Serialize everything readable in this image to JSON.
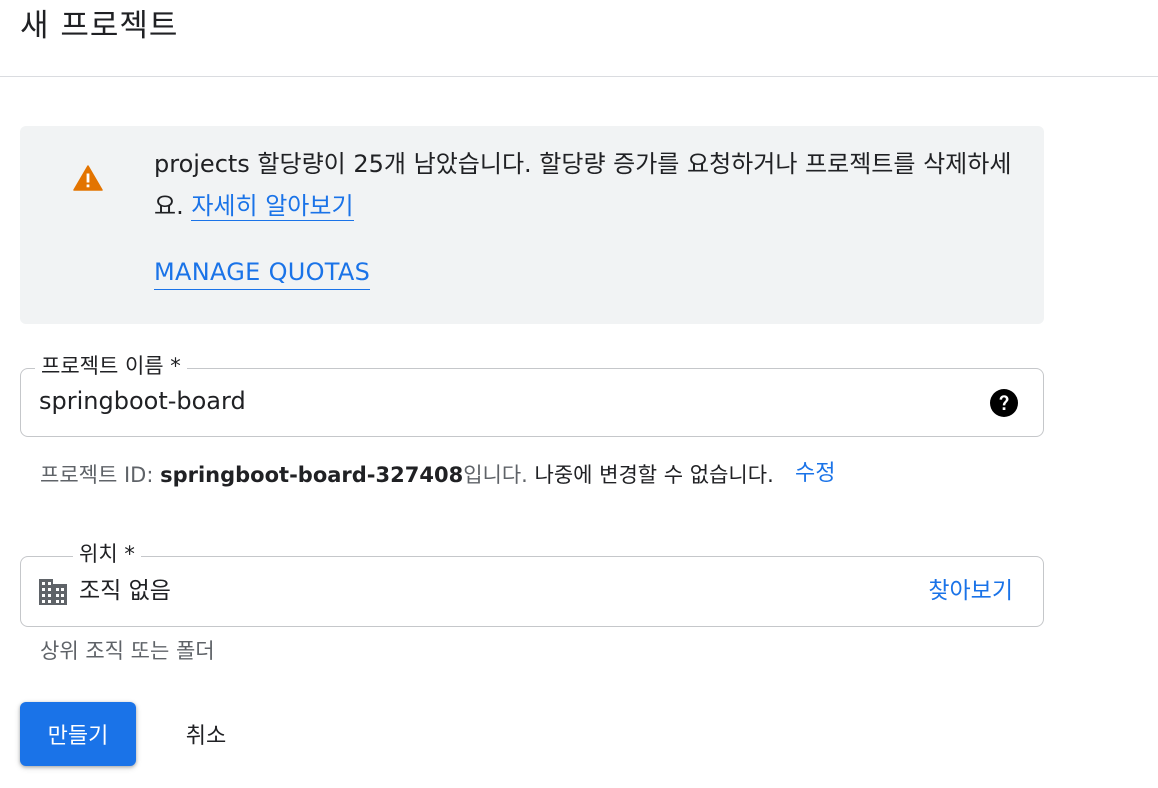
{
  "header": {
    "title": "새 프로젝트"
  },
  "notice": {
    "icon": "warning-icon",
    "message": "projects 할당량이 25개 남았습니다. 할당량 증가를 요청하거나 프로젝트를 삭제하세요. ",
    "learn_more_label": "자세히 알아보기",
    "manage_quotas_label": "MANAGE QUOTAS"
  },
  "project_name": {
    "label": "프로젝트 이름 *",
    "value": "springboot-board",
    "help_icon": "help-icon"
  },
  "project_id": {
    "prefix": "프로젝트 ID: ",
    "id": "springboot-board-327408",
    "suffix": "입니다.",
    "note": " 나중에 변경할 수 없습니다.",
    "edit_label": "수정"
  },
  "location": {
    "label": "위치 *",
    "icon": "building-icon",
    "value": "조직 없음",
    "browse_label": "찾아보기",
    "hint": "상위 조직 또는 폴더"
  },
  "actions": {
    "create_label": "만들기",
    "cancel_label": "취소"
  },
  "colors": {
    "accent": "#1a73e8",
    "warning": "#e37400",
    "notice_bg": "#f1f3f4"
  }
}
